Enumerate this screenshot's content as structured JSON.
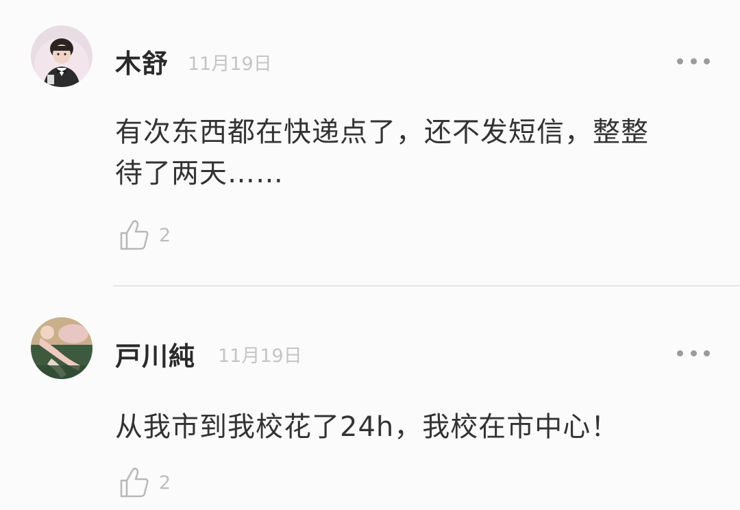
{
  "comments": [
    {
      "username": "木舒",
      "date": "11月19日",
      "content": "有次东西都在快递点了，还不发短信，整整\n待了两天……",
      "likes": "2",
      "avatar_icon": "avatar-child-with-bow-tie",
      "more_icon": "more-dots-icon",
      "like_icon": "thumbs-up-icon"
    },
    {
      "username": "戸川純",
      "date": "11月19日",
      "content": "从我市到我校花了24h，我校在市中心！",
      "likes": "2",
      "avatar_icon": "avatar-reclining-figure",
      "more_icon": "more-dots-icon",
      "like_icon": "thumbs-up-icon"
    }
  ],
  "colors": {
    "background": "#fbfbfb",
    "username": "#2a2a2a",
    "text": "#333333",
    "muted": "#c4c4c4",
    "icon": "#9b9b9b",
    "divider": "#e6e6e6"
  }
}
